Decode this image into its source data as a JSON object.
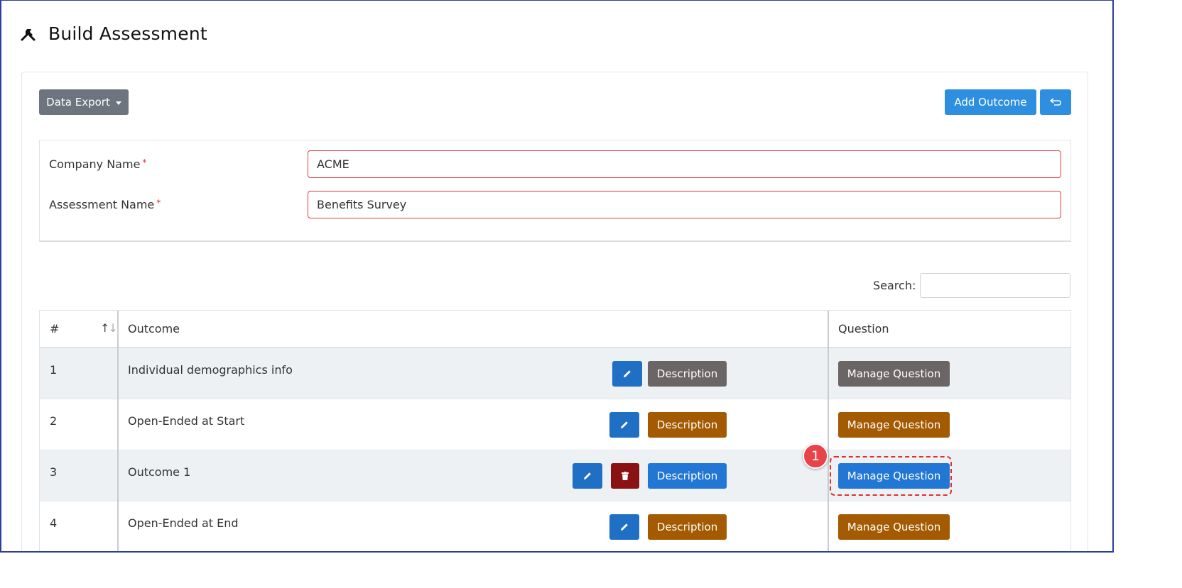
{
  "page": {
    "title": "Build Assessment",
    "title_icon": "tools-icon"
  },
  "toolbar": {
    "export_label": "Data Export",
    "add_outcome_label": "Add Outcome",
    "back_icon": "return-arrow-icon",
    "back_symbol": "⮌"
  },
  "form": {
    "company_label": "Company Name",
    "company_value": "ACME",
    "assessment_label": "Assessment Name",
    "assessment_value": "Benefits Survey",
    "required_marker": "*"
  },
  "search": {
    "label": "Search:",
    "value": ""
  },
  "table": {
    "headers": {
      "number": "#",
      "outcome": "Outcome",
      "question": "Question"
    },
    "rows": [
      {
        "num": "1",
        "outcome": "Individual demographics info",
        "description": "Description",
        "manage": "Manage Question"
      },
      {
        "num": "2",
        "outcome": "Open-Ended at Start",
        "description": "Description",
        "manage": "Manage Question"
      },
      {
        "num": "3",
        "outcome": "Outcome 1",
        "description": "Description",
        "manage": "Manage Question"
      },
      {
        "num": "4",
        "outcome": "Open-Ended at End",
        "description": "Description",
        "manage": "Manage Question"
      }
    ]
  },
  "annotation": {
    "step_number": "1"
  },
  "colors": {
    "primary": "#2e8fe0",
    "edit": "#1f6fc5",
    "delete": "#8b1212",
    "orange": "#a35a00",
    "gray": "#6c6565",
    "highlight": "#e03131"
  }
}
